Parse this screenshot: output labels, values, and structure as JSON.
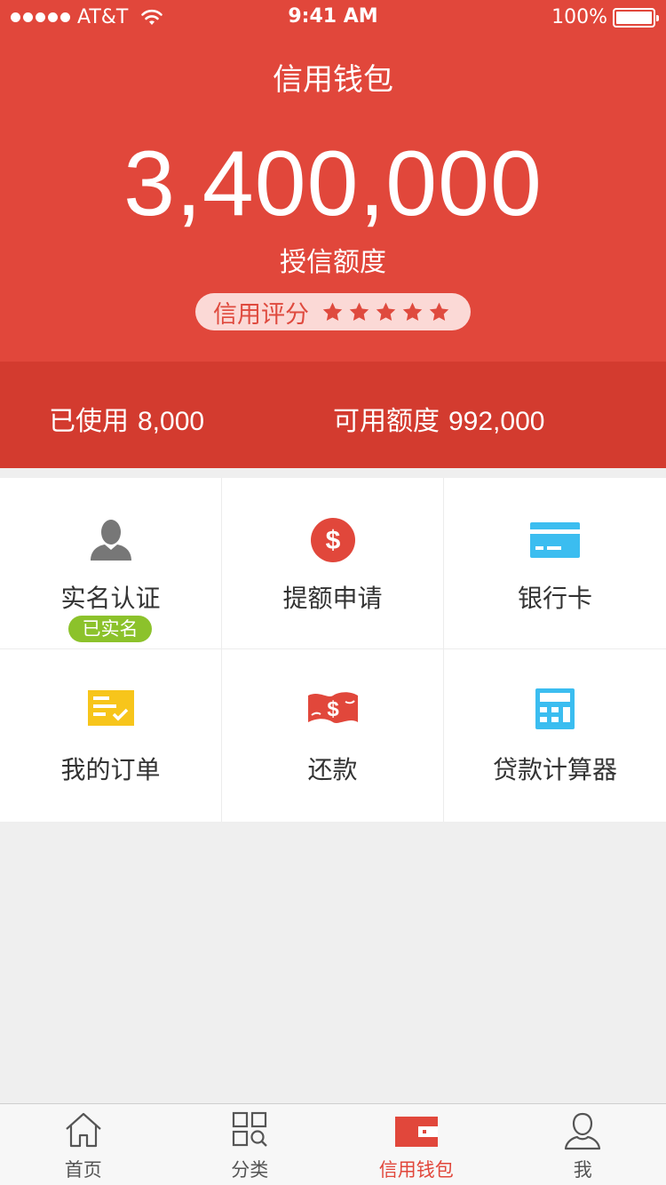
{
  "status_bar": {
    "carrier": "AT&T",
    "time": "9:41 AM",
    "battery": "100%"
  },
  "header": {
    "title": "信用钱包",
    "credit_amount": "3,400,000",
    "credit_label": "授信额度",
    "score_label": "信用评分",
    "score_stars": 5
  },
  "usage": {
    "used_label": "已使用",
    "used_value": "8,000",
    "available_label": "可用额度",
    "available_value": "992,000"
  },
  "grid": {
    "items": [
      {
        "label": "实名认证",
        "icon": "user-icon",
        "badge": "已实名"
      },
      {
        "label": "提额申请",
        "icon": "dollar-icon"
      },
      {
        "label": "银行卡",
        "icon": "bank-card-icon"
      },
      {
        "label": "我的订单",
        "icon": "order-list-icon"
      },
      {
        "label": "还款",
        "icon": "money-bill-icon"
      },
      {
        "label": "贷款计算器",
        "icon": "calculator-icon"
      }
    ]
  },
  "tabbar": {
    "items": [
      {
        "label": "首页",
        "icon": "home-icon"
      },
      {
        "label": "分类",
        "icon": "category-icon"
      },
      {
        "label": "信用钱包",
        "icon": "wallet-icon",
        "active": true
      },
      {
        "label": "我",
        "icon": "profile-icon"
      }
    ]
  },
  "colors": {
    "primary": "#e1473b",
    "primary_dark": "#d33b2f",
    "badge_green": "#8cc22b",
    "icon_blue": "#3bbdf0",
    "icon_yellow": "#f7c51b",
    "icon_gray": "#777777"
  }
}
